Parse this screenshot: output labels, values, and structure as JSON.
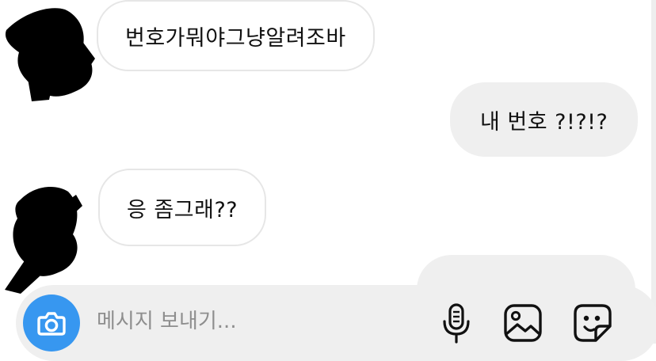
{
  "messages": [
    {
      "side": "incoming",
      "text": "번호가뭐야그냥알려조바"
    },
    {
      "side": "outgoing",
      "text": "내 번호 ?!?!?"
    },
    {
      "side": "incoming",
      "text": "응 좀그래??"
    },
    {
      "side": "outgoing",
      "text": ""
    }
  ],
  "composer": {
    "placeholder": "메시지 보내기...",
    "value": "",
    "icons": [
      "camera-icon",
      "microphone-icon",
      "gallery-icon",
      "sticker-icon"
    ]
  },
  "colors": {
    "accent": "#3797f0",
    "incoming_bubble": "#ffffff",
    "outgoing_bubble": "#efefef",
    "composer_bg": "#efefef",
    "placeholder": "#8e8e8e",
    "redaction": "#000000"
  }
}
